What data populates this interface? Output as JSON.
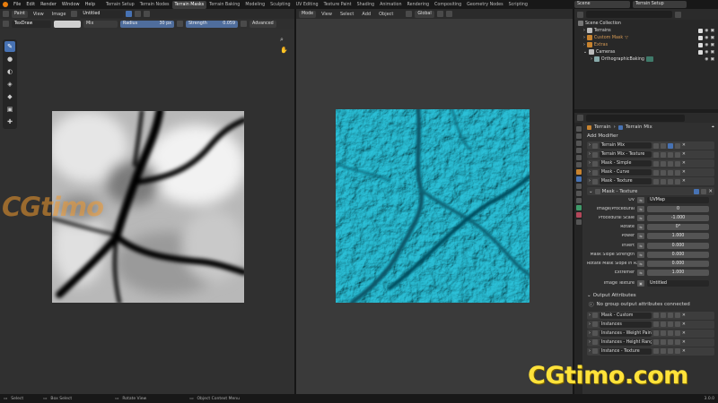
{
  "menubar": {
    "items": [
      "File",
      "Edit",
      "Render",
      "Window",
      "Help"
    ],
    "workspaces": [
      "Terrain Setup",
      "Terrain Nodes",
      "Terrain Masks",
      "Terrain Baking",
      "Modeling",
      "Sculpting",
      "UV Editing",
      "Texture Paint",
      "Shading",
      "Animation",
      "Rendering",
      "Compositing",
      "Geometry Nodes",
      "Scripting"
    ],
    "active_workspace": "Terrain Masks",
    "scene": "Scene",
    "view_layer": "Terrain Setup"
  },
  "image_editor": {
    "mode": "Paint",
    "menus": [
      "View",
      "Image"
    ],
    "image_name": "Untitled",
    "brush": "TexDraw",
    "blend": "Mix",
    "radius_label": "Radius",
    "radius_value": "30 px",
    "strength_label": "Strength",
    "strength_value": "0.059",
    "advanced": "Advanced"
  },
  "viewport": {
    "mode": "Mode",
    "menus": [
      "View",
      "Select",
      "Add",
      "Object"
    ],
    "orientation": "Global"
  },
  "outliner": {
    "title": "Scene Collection",
    "items": [
      {
        "label": "Terrains",
        "color": "#d9d9d9"
      },
      {
        "label": "Custom Mask",
        "color": "#c8832f"
      },
      {
        "label": "Extras",
        "color": "#c8832f"
      },
      {
        "label": "Cameras",
        "color": "#d9d9d9"
      },
      {
        "label": "OrthographicBaking",
        "color": "#d9d9d9"
      }
    ]
  },
  "properties": {
    "breadcrumb": [
      "Terrain",
      "Terrain Mix"
    ],
    "add_modifier": "Add Modifier",
    "modifiers_top": [
      "Terrain Mix",
      "Terrain Mix - Texture",
      "Mask - Simple",
      "Mask - Curve",
      "Mask - Texture"
    ],
    "expanded_modifier": "Mask - Texture",
    "params": [
      {
        "label": "UV",
        "value": "UVMap",
        "dark": true
      },
      {
        "label": "Image/Procedural",
        "value": "0"
      },
      {
        "label": "Procedural Scale",
        "value": "-1.000"
      },
      {
        "label": "Rotate",
        "value": "0°"
      },
      {
        "label": "Power",
        "value": "1.000"
      },
      {
        "label": "Invert",
        "value": "0.000"
      },
      {
        "label": "Mask Slope Strength",
        "value": "0.000"
      },
      {
        "label": "Rotate Mask Slope in R...",
        "value": "0.000"
      },
      {
        "label": "Extremer",
        "value": "1.000"
      }
    ],
    "image_texture_label": "Image Texture",
    "image_texture_value": "Untitled",
    "output_attributes": "Output Attributes",
    "no_output": "No group output attributes connected",
    "modifiers_bottom": [
      "Mask - Custom",
      "Instances",
      "Instances - Weight Paint",
      "Instances - Height Range",
      "Instance - Texture"
    ]
  },
  "statusbar": {
    "items": [
      "Select",
      "Box Select",
      "Rotate View",
      "Object Context Menu"
    ],
    "version": "3.0.0"
  },
  "watermarks": {
    "left": "CGtimo",
    "bottom_right": "CGtimo.com"
  },
  "colors": {
    "accent": "#4772b3",
    "terrain_cyan": "#1fb4cc",
    "watermark_orange": "#f29a2e",
    "watermark_yellow": "#ffe23a"
  }
}
